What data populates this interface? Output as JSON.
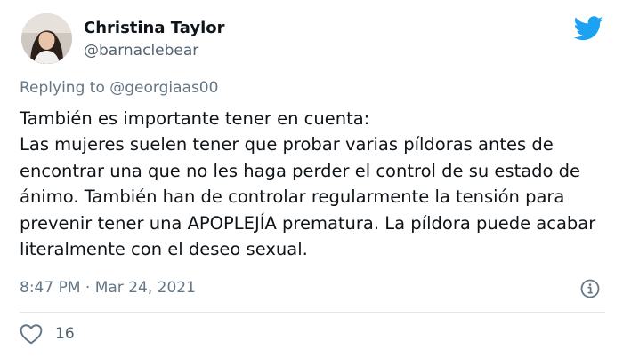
{
  "tweet": {
    "author_name": "Christina Taylor",
    "author_handle": "@barnaclebear",
    "replying_to_prefix": "Replying to ",
    "replying_to_handle": "@georgiaas00",
    "text": "También es importante tener en cuenta:\nLas mujeres suelen tener que probar varias píldoras antes de encontrar una que no les haga perder el control de su estado de ánimo. También han de controlar regularmente la tensión para prevenir tener una APOPLEJÍA prematura. La píldora puede acabar literalmente con el deseo sexual.",
    "timestamp": "8:47 PM · Mar 24, 2021",
    "like_count": "16"
  },
  "icons": {
    "brand": "twitter-bird-icon",
    "info": "info-icon",
    "like": "heart-icon"
  },
  "colors": {
    "brand": "#1da1f2",
    "secondary_text": "#657786",
    "primary_text": "#0f1419",
    "divider": "#e1e8ed"
  }
}
